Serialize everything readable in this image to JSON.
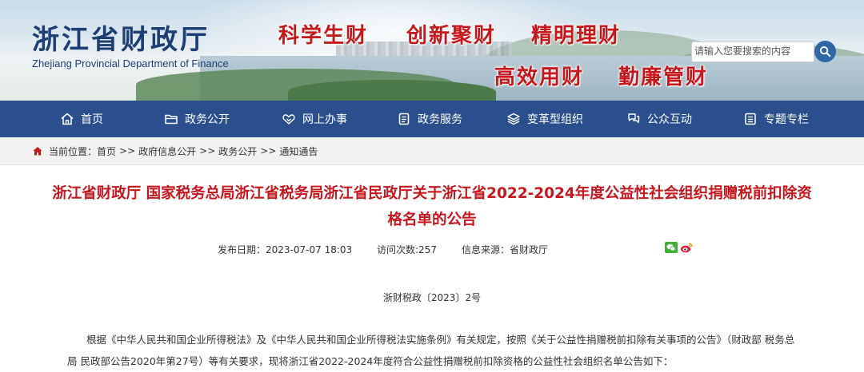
{
  "header": {
    "logo_cn": "浙江省财政厅",
    "logo_en": "Zhejiang Provincial Department of Finance",
    "slogans": [
      "科学生财",
      "创新聚财",
      "精明理财",
      "高效用财",
      "勤廉管财"
    ],
    "search_placeholder": "请输入您要搜索的内容"
  },
  "nav": {
    "items": [
      {
        "label": "首页",
        "icon": "home-icon"
      },
      {
        "label": "政务公开",
        "icon": "folder-icon"
      },
      {
        "label": "网上办事",
        "icon": "handshake-icon"
      },
      {
        "label": "政务服务",
        "icon": "document-icon"
      },
      {
        "label": "变革型组织",
        "icon": "layers-icon"
      },
      {
        "label": "公众互动",
        "icon": "chat-icon"
      },
      {
        "label": "专题专栏",
        "icon": "list-icon"
      }
    ]
  },
  "breadcrumb": {
    "prefix": "当前位置：",
    "items": [
      "首页",
      "政府信息公开",
      "政务公开",
      "通知通告"
    ],
    "separator": ">>"
  },
  "article": {
    "title": "浙江省财政厅 国家税务总局浙江省税务局浙江省民政厅关于浙江省2022-2024年度公益性社会组织捐赠税前扣除资格名单的公告",
    "publish_label": "发布日期：",
    "publish_date": "2023-07-07 18:03",
    "visits_label": "访问次数:",
    "visits": "257",
    "source_label": "信息来源：",
    "source": "省财政厅",
    "doc_number": "浙财税政〔2023〕2号",
    "body": "根据《中华人民共和国企业所得税法》及《中华人民共和国企业所得税法实施条例》有关规定，按照《关于公益性捐赠税前扣除有关事项的公告》（财政部 税务总局 民政部公告2020年第27号）等有关要求，现将浙江省2022-2024年度符合公益性捐赠税前扣除资格的公益性社会组织名单公告如下："
  },
  "colors": {
    "nav_bg": "#2a4f8c",
    "title_red": "#c8161d",
    "logo_blue": "#1e3f73"
  },
  "share_icons": [
    "wechat-icon",
    "weibo-icon"
  ]
}
